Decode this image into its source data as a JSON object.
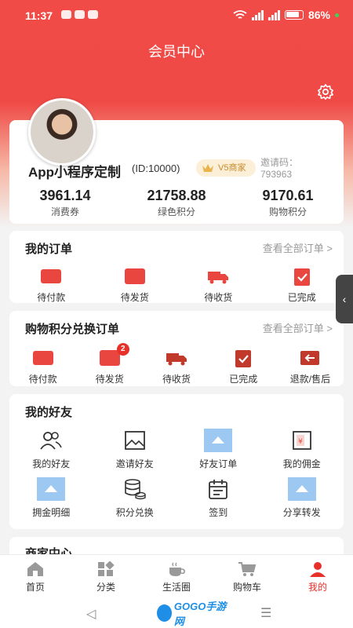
{
  "status_bar": {
    "time": "11:37",
    "battery": "86%",
    "network_4g": "4G",
    "network_5g": "5G"
  },
  "header": {
    "title": "会员中心"
  },
  "profile": {
    "name": "App小程序定制",
    "id_text": "(ID:10000)",
    "level_badge": "V5商家",
    "invite_label": "邀请码：",
    "invite_code": "793963",
    "stats": [
      {
        "value": "3961.14",
        "label": "消费券"
      },
      {
        "value": "21758.88",
        "label": "绿色积分"
      },
      {
        "value": "9170.61",
        "label": "购物积分"
      }
    ]
  },
  "orders": {
    "title": "我的订单",
    "more": "查看全部订单 >",
    "items": [
      {
        "label": "待付款",
        "icon": "wallet-icon"
      },
      {
        "label": "待发货",
        "icon": "box-icon"
      },
      {
        "label": "待收货",
        "icon": "truck-icon"
      },
      {
        "label": "已完成",
        "icon": "clipboard-check-icon"
      }
    ]
  },
  "points_orders": {
    "title": "购物积分兑换订单",
    "more": "查看全部订单 >",
    "items": [
      {
        "label": "待付款",
        "icon": "wallet-icon"
      },
      {
        "label": "待发货",
        "icon": "box-icon",
        "badge": "2"
      },
      {
        "label": "待收货",
        "icon": "truck-icon"
      },
      {
        "label": "已完成",
        "icon": "clipboard-check-icon"
      },
      {
        "label": "退款/售后",
        "icon": "refund-icon"
      }
    ]
  },
  "friends": {
    "title": "我的好友",
    "row1": [
      {
        "label": "我的好友",
        "icon": "users-icon"
      },
      {
        "label": "邀请好友",
        "icon": "image-frame-icon"
      },
      {
        "label": "好友订单",
        "icon": "image-placeholder-icon"
      },
      {
        "label": "我的佣金",
        "icon": "money-icon"
      }
    ],
    "row2": [
      {
        "label": "拥金明细",
        "icon": "image-placeholder-icon"
      },
      {
        "label": "积分兑换",
        "icon": "database-icon"
      },
      {
        "label": "签到",
        "icon": "calendar-icon"
      },
      {
        "label": "分享转发",
        "icon": "image-placeholder-icon"
      }
    ]
  },
  "next_section": {
    "title": "商家中心"
  },
  "tabbar": {
    "items": [
      {
        "label": "首页",
        "icon": "home-icon"
      },
      {
        "label": "分类",
        "icon": "category-icon"
      },
      {
        "label": "生活圈",
        "icon": "coffee-icon"
      },
      {
        "label": "购物车",
        "icon": "cart-icon"
      },
      {
        "label": "我的",
        "icon": "user-icon",
        "active": true
      }
    ]
  },
  "watermark": {
    "text": "GOGO手游网"
  },
  "colors": {
    "brand_red": "#ef4a46",
    "accent_red": "#e8302a",
    "gold": "#c98a2a"
  }
}
